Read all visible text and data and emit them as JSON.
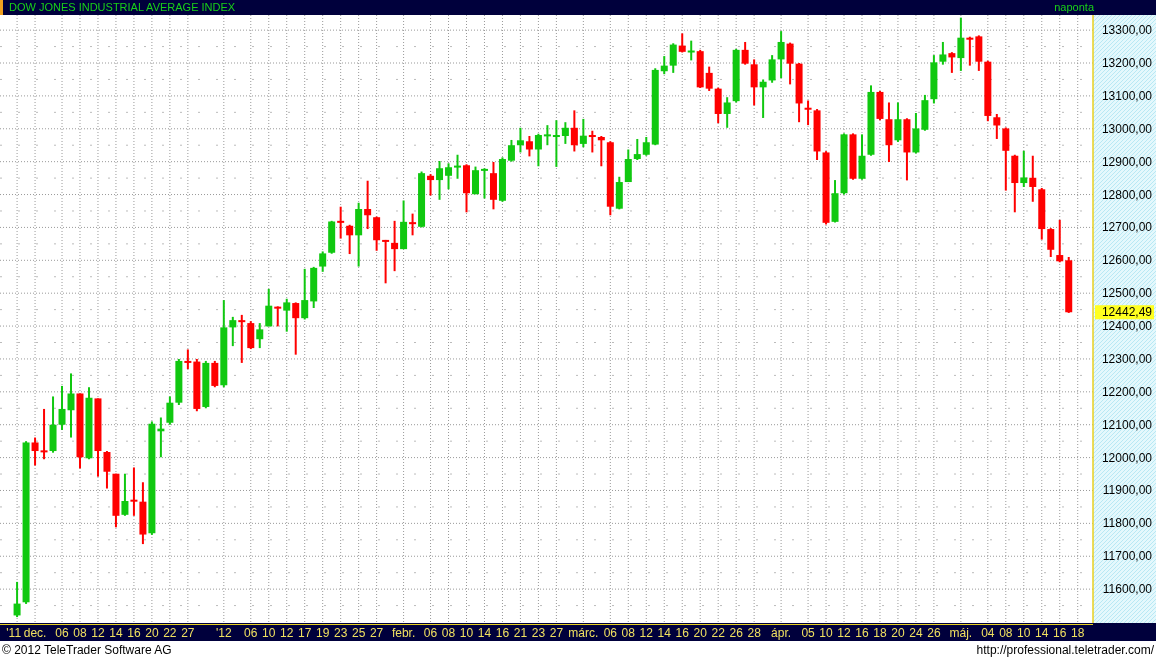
{
  "header": {
    "title": "DOW JONES INDUSTRIAL AVERAGE INDEX",
    "interval": "naponta"
  },
  "chart": {
    "last_price": "12442,49",
    "chart_data": {
      "type": "candlestick",
      "grid": true,
      "ylim": [
        11497,
        13346
      ],
      "yticks": [
        {
          "value": 11600,
          "label": "11600,00"
        },
        {
          "value": 11700,
          "label": "11700,00"
        },
        {
          "value": 11800,
          "label": "11800,00"
        },
        {
          "value": 11900,
          "label": "11900,00"
        },
        {
          "value": 12000,
          "label": "12000,00"
        },
        {
          "value": 12100,
          "label": "12100,00"
        },
        {
          "value": 12200,
          "label": "12200,00"
        },
        {
          "value": 12300,
          "label": "12300,00"
        },
        {
          "value": 12400,
          "label": "12400,00"
        },
        {
          "value": 12500,
          "label": "12500,00"
        },
        {
          "value": 12600,
          "label": "12600,00"
        },
        {
          "value": 12700,
          "label": "12700,00"
        },
        {
          "value": 12800,
          "label": "12800,00"
        },
        {
          "value": 12900,
          "label": "12900,00"
        },
        {
          "value": 13000,
          "label": "13000,00"
        },
        {
          "value": 13100,
          "label": "13100,00"
        },
        {
          "value": 13200,
          "label": "13200,00"
        },
        {
          "value": 13300,
          "label": "13300,00"
        }
      ],
      "categories": [
        "'11",
        null,
        "dec.",
        null,
        null,
        "06",
        null,
        "08",
        null,
        "12",
        null,
        "14",
        null,
        "16",
        null,
        "20",
        null,
        "22",
        null,
        "27",
        null,
        null,
        null,
        "'12",
        null,
        null,
        "06",
        null,
        "10",
        null,
        "12",
        null,
        "17",
        null,
        "19",
        null,
        "23",
        null,
        "25",
        null,
        "27",
        null,
        null,
        "febr.",
        null,
        null,
        "06",
        null,
        "08",
        null,
        "10",
        null,
        "14",
        null,
        "16",
        null,
        "21",
        null,
        "23",
        null,
        "27",
        null,
        null,
        "márc.",
        null,
        null,
        "06",
        null,
        "08",
        null,
        "12",
        null,
        "14",
        null,
        "16",
        null,
        "20",
        null,
        "22",
        null,
        "26",
        null,
        "28",
        null,
        null,
        "ápr.",
        null,
        null,
        "05",
        null,
        "10",
        null,
        "12",
        null,
        "16",
        null,
        "18",
        null,
        "20",
        null,
        "24",
        null,
        "26",
        null,
        null,
        "máj.",
        null,
        null,
        "04",
        null,
        "08",
        null,
        "10",
        null,
        "14",
        null,
        "16",
        null,
        "18"
      ],
      "ohlc": [
        [
          11520,
          11622,
          11515,
          11556
        ],
        [
          11560,
          12050,
          11555,
          12046
        ],
        [
          12046,
          12061,
          11976,
          12020
        ],
        [
          12022,
          12148,
          11995,
          12018
        ],
        [
          12020,
          12186,
          12015,
          12100
        ],
        [
          12100,
          12218,
          12084,
          12148
        ],
        [
          12144,
          12256,
          12061,
          12195
        ],
        [
          12195,
          12195,
          11967,
          12001
        ],
        [
          11998,
          12214,
          11995,
          12182
        ],
        [
          12180,
          12180,
          11942,
          12020
        ],
        [
          12017,
          12020,
          11906,
          11957
        ],
        [
          11951,
          11951,
          11788,
          11823
        ],
        [
          11826,
          11951,
          11823,
          11868
        ],
        [
          11872,
          11970,
          11823,
          11868
        ],
        [
          11866,
          11925,
          11737,
          11766
        ],
        [
          11770,
          12110,
          11765,
          12103
        ],
        [
          12080,
          12122,
          12001,
          12088
        ],
        [
          12106,
          12186,
          12100,
          12167
        ],
        [
          12167,
          12300,
          12160,
          12294
        ],
        [
          12294,
          12329,
          12269,
          12290
        ],
        [
          12292,
          12300,
          12141,
          12148
        ],
        [
          12154,
          12294,
          12150,
          12288
        ],
        [
          12288,
          12294,
          12214,
          12218
        ],
        [
          12220,
          12479,
          12214,
          12396
        ],
        [
          12396,
          12428,
          12339,
          12418
        ],
        [
          12418,
          12434,
          12288,
          12414
        ],
        [
          12409,
          12415,
          12330,
          12333
        ],
        [
          12360,
          12409,
          12333,
          12390
        ],
        [
          12399,
          12513,
          12399,
          12462
        ],
        [
          12459,
          12460,
          12399,
          12454
        ],
        [
          12447,
          12483,
          12383,
          12472
        ],
        [
          12470,
          12472,
          12313,
          12424
        ],
        [
          12424,
          12574,
          12420,
          12479
        ],
        [
          12475,
          12580,
          12455,
          12577
        ],
        [
          12581,
          12627,
          12565,
          12621
        ],
        [
          12623,
          12720,
          12620,
          12718
        ],
        [
          12720,
          12763,
          12666,
          12714
        ],
        [
          12705,
          12708,
          12619,
          12676
        ],
        [
          12676,
          12775,
          12581,
          12756
        ],
        [
          12756,
          12842,
          12695,
          12737
        ],
        [
          12731,
          12733,
          12629,
          12661
        ],
        [
          12662,
          12662,
          12530,
          12658
        ],
        [
          12653,
          12720,
          12567,
          12634
        ],
        [
          12634,
          12782,
          12634,
          12717
        ],
        [
          12716,
          12742,
          12676,
          12712
        ],
        [
          12702,
          12870,
          12700,
          12865
        ],
        [
          12857,
          12862,
          12797,
          12844
        ],
        [
          12844,
          12902,
          12784,
          12880
        ],
        [
          12857,
          12895,
          12816,
          12883
        ],
        [
          12884,
          12921,
          12848,
          12888
        ],
        [
          12889,
          12892,
          12746,
          12804
        ],
        [
          12801,
          12885,
          12801,
          12874
        ],
        [
          12874,
          12880,
          12788,
          12878
        ],
        [
          12865,
          12899,
          12755,
          12784
        ],
        [
          12781,
          12913,
          12778,
          12908
        ],
        [
          12903,
          12966,
          12900,
          12950
        ],
        [
          12950,
          13003,
          12928,
          12965
        ],
        [
          12962,
          12978,
          12916,
          12937
        ],
        [
          12937,
          12985,
          12886,
          12981
        ],
        [
          12979,
          13011,
          12950,
          12983
        ],
        [
          12977,
          13026,
          12884,
          12981
        ],
        [
          12978,
          13020,
          12954,
          13003
        ],
        [
          13003,
          13056,
          12931,
          12950
        ],
        [
          12954,
          13030,
          12944,
          12979
        ],
        [
          12981,
          12994,
          12928,
          12977
        ],
        [
          12975,
          12978,
          12886,
          12965
        ],
        [
          12959,
          12962,
          12737,
          12763
        ],
        [
          12757,
          12854,
          12755,
          12838
        ],
        [
          12838,
          12937,
          12838,
          12908
        ],
        [
          12908,
          12969,
          12905,
          12923
        ],
        [
          12921,
          12975,
          12918,
          12959
        ],
        [
          12952,
          13184,
          12950,
          13179
        ],
        [
          13175,
          13221,
          13166,
          13192
        ],
        [
          13192,
          13260,
          13170,
          13256
        ],
        [
          13253,
          13290,
          13232,
          13234
        ],
        [
          13234,
          13268,
          13208,
          13238
        ],
        [
          13236,
          13240,
          13124,
          13126
        ],
        [
          13170,
          13189,
          13115,
          13122
        ],
        [
          13122,
          13125,
          13017,
          13045
        ],
        [
          13045,
          13096,
          13003,
          13080
        ],
        [
          13084,
          13243,
          13080,
          13240
        ],
        [
          13240,
          13264,
          13195,
          13198
        ],
        [
          13196,
          13211,
          13071,
          13126
        ],
        [
          13126,
          13150,
          13033,
          13143
        ],
        [
          13147,
          13224,
          13140,
          13211
        ],
        [
          13211,
          13297,
          13154,
          13264
        ],
        [
          13259,
          13262,
          13135,
          13198
        ],
        [
          13198,
          13200,
          13020,
          13077
        ],
        [
          13064,
          13086,
          13011,
          13060
        ],
        [
          13056,
          13060,
          12905,
          12931
        ],
        [
          12928,
          12932,
          12709,
          12714
        ],
        [
          12717,
          12844,
          12715,
          12804
        ],
        [
          12804,
          12986,
          12800,
          12983
        ],
        [
          12983,
          12986,
          12845,
          12848
        ],
        [
          12848,
          12983,
          12845,
          12918
        ],
        [
          12921,
          13132,
          12918,
          13112
        ],
        [
          13112,
          13115,
          13026,
          13030
        ],
        [
          13029,
          13080,
          12899,
          12950
        ],
        [
          12965,
          13080,
          12960,
          13029
        ],
        [
          13029,
          13032,
          12843,
          12928
        ],
        [
          12928,
          13048,
          12925,
          13001
        ],
        [
          12997,
          13103,
          12994,
          13087
        ],
        [
          13090,
          13224,
          13077,
          13202
        ],
        [
          13204,
          13264,
          13195,
          13226
        ],
        [
          13230,
          13233,
          13170,
          13217
        ],
        [
          13215,
          13338,
          13176,
          13277
        ],
        [
          13277,
          13280,
          13192,
          13273
        ],
        [
          13281,
          13284,
          13176,
          13204
        ],
        [
          13204,
          13207,
          13023,
          13039
        ],
        [
          13035,
          13045,
          12969,
          13010
        ],
        [
          13001,
          13004,
          12812,
          12933
        ],
        [
          12918,
          12921,
          12746,
          12835
        ],
        [
          12835,
          12933,
          12823,
          12852
        ],
        [
          12851,
          12918,
          12778,
          12823
        ],
        [
          12816,
          12820,
          12663,
          12695
        ],
        [
          12695,
          12698,
          12610,
          12632
        ],
        [
          12616,
          12723,
          12594,
          12597
        ],
        [
          12600,
          12610,
          12440,
          12442
        ],
        null
      ]
    }
  },
  "footer": {
    "copyright": "© 2012 TeleTrader Software AG",
    "url": "http://professional.teletrader.com/"
  }
}
